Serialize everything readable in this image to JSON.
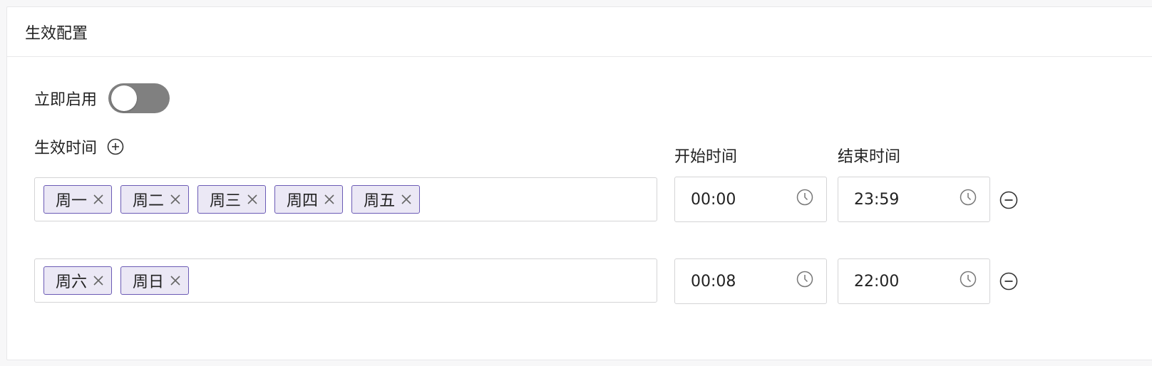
{
  "card": {
    "title": "生效配置"
  },
  "enable": {
    "label": "立即启用",
    "on": false
  },
  "schedule": {
    "label": "生效时间",
    "start_label": "开始时间",
    "end_label": "结束时间",
    "rows": [
      {
        "days": [
          "周一",
          "周二",
          "周三",
          "周四",
          "周五"
        ],
        "start": "00:00",
        "end": "23:59"
      },
      {
        "days": [
          "周六",
          "周日"
        ],
        "start": "00:08",
        "end": "22:00"
      }
    ]
  },
  "colors": {
    "tag_bg": "#ebe8f5",
    "tag_border": "#6b5bb5",
    "toggle_off": "#808080"
  },
  "icons": [
    "plus-circle-icon",
    "clock-icon",
    "close-icon",
    "minus-circle-icon"
  ]
}
